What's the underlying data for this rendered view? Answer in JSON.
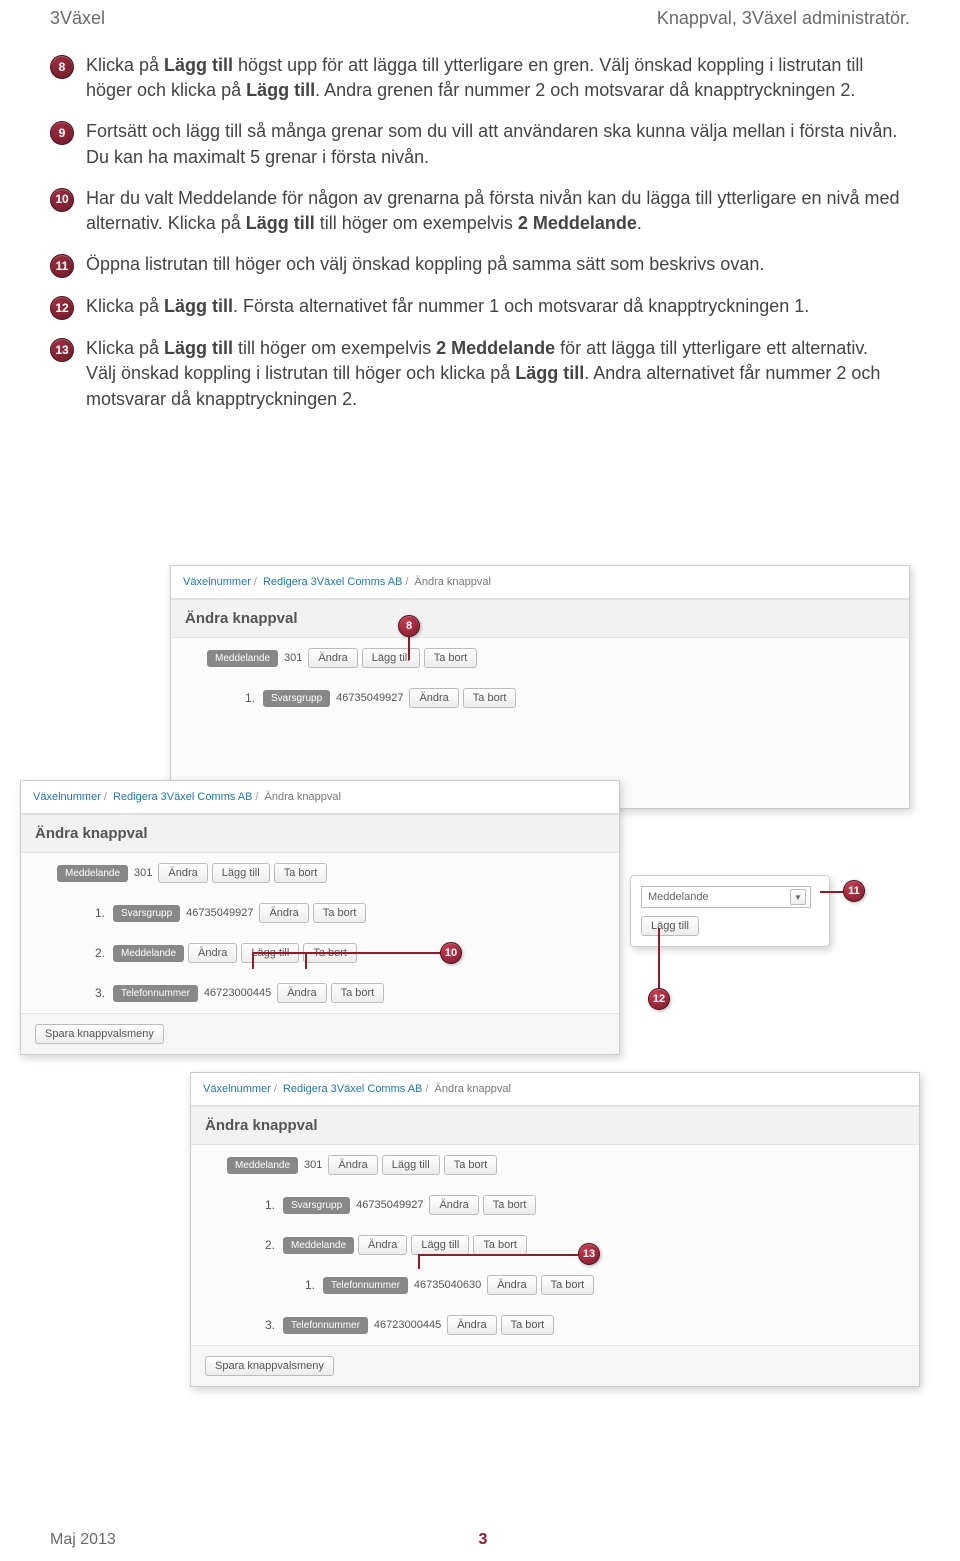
{
  "header": {
    "left": "3Växel",
    "right": "Knappval, 3Växel administratör."
  },
  "steps": {
    "s8": {
      "n": "8",
      "t": "Klicka på <b>Lägg till</b> högst upp för att lägga till ytterligare en gren. Välj önskad koppling i listrutan till höger och klicka på <b>Lägg till</b>. Andra grenen får nummer 2 och motsvarar då knapptryckningen 2."
    },
    "s9": {
      "n": "9",
      "t": "Fortsätt och lägg till så många grenar som du vill att användaren ska kunna välja mellan i första nivån. Du kan ha maximalt 5 grenar i första nivån."
    },
    "s10": {
      "n": "10",
      "t": "Har du valt Meddelande för någon av grenarna på första nivån kan du lägga till ytterligare en nivå med alternativ. Klicka på <b>Lägg till</b> till höger om exempelvis <b>2 Meddelande</b>."
    },
    "s11": {
      "n": "11",
      "t": "Öppna listrutan till höger och välj önskad koppling på samma sätt som beskrivs ovan."
    },
    "s12": {
      "n": "12",
      "t": "Klicka på <b>Lägg till</b>. Första alternativet får nummer 1 och motsvarar då knapptryckningen 1."
    },
    "s13": {
      "n": "13",
      "t": "Klicka på <b>Lägg till</b> till höger om exempelvis <b>2 Meddelande</b> för att lägga till ytterligare ett alternativ. Välj önskad koppling i listrutan till höger och klicka på <b>Lägg till</b>. Andra alternativet får nummer 2 och motsvarar då knapptryckningen 2."
    }
  },
  "ui": {
    "breadcrumb": {
      "a": "Växelnummer",
      "b": "Redigera 3Växel Comms AB",
      "c": "Ändra knappval"
    },
    "title": "Ändra knappval",
    "tags": {
      "medd": "Meddelande",
      "svar": "Svarsgrupp",
      "tel": "Telefonnummer"
    },
    "vals": {
      "v301": "301",
      "p1": "46735049927",
      "p2": "46723000445",
      "p3": "46735040630"
    },
    "btns": {
      "andra": "Ändra",
      "lagg": "Lägg till",
      "tabort": "Ta bort",
      "spara": "Spara knappvalsmeny"
    },
    "nums": {
      "n1": "1.",
      "n2": "2.",
      "n3": "3."
    },
    "dd": {
      "label": "Meddelande"
    }
  },
  "callouts": {
    "c8": "8",
    "c10": "10",
    "c11": "11",
    "c12": "12",
    "c13": "13"
  },
  "footer": {
    "left": "Maj 2013",
    "page": "3"
  }
}
